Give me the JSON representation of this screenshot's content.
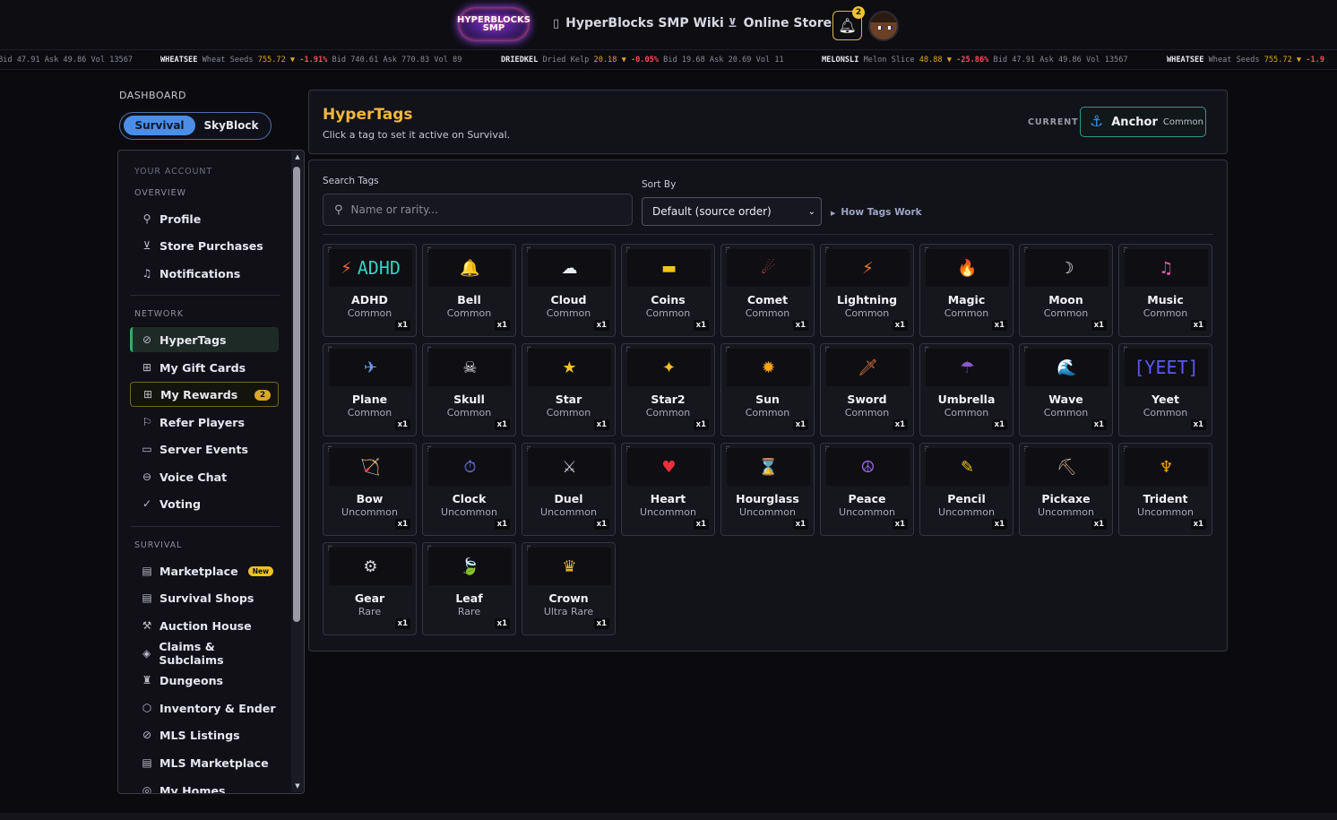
{
  "topnav": {
    "logo_line1": "HYPERBLOCKS",
    "logo_line2": "SMP",
    "wiki_label": "HyperBlocks SMP Wiki",
    "wiki_icon": "book-icon",
    "store_label": "Online Store",
    "store_icon": "cart-icon",
    "notification_count": "2"
  },
  "ticker": [
    {
      "sym": "",
      "name": "",
      "price": "",
      "chg": "",
      "rest": "Bid 47.91 Ask 49.86 Vol 13567"
    },
    {
      "sym": "WHEATSEE",
      "name": "Wheat Seeds",
      "price": "755.72 ▼",
      "chg": "-1.91%",
      "rest": "Bid 740.61 Ask 770.83 Vol 89"
    },
    {
      "sym": "DRIEDKEL",
      "name": "Dried Kelp",
      "price": "20.18 ▼",
      "chg": "-0.05%",
      "rest": "Bid 19.68 Ask 20.69 Vol 11"
    },
    {
      "sym": "MELONSLI",
      "name": "Melon Slice",
      "price": "48.88 ▼",
      "chg": "-25.86%",
      "rest": "Bid 47.91 Ask 49.86 Vol 13567"
    },
    {
      "sym": "WHEATSEE",
      "name": "Wheat Seeds",
      "price": "755.72 ▼",
      "chg": "-1.9",
      "rest": ""
    }
  ],
  "dashboard": {
    "label": "DASHBOARD",
    "mode_active": "Survival",
    "mode_other": "SkyBlock"
  },
  "sidebar": {
    "your_account": "YOUR ACCOUNT",
    "overview": "OVERVIEW",
    "network": "NETWORK",
    "survival": "SURVIVAL",
    "items": [
      {
        "label": "Profile",
        "icon": "user-icon"
      },
      {
        "label": "Store Purchases",
        "icon": "cart-icon"
      },
      {
        "label": "Notifications",
        "icon": "bell-icon"
      },
      {
        "label": "HyperTags",
        "icon": "tag-icon"
      },
      {
        "label": "My Gift Cards",
        "icon": "gift-icon"
      },
      {
        "label": "My Rewards",
        "icon": "gift-icon",
        "badge": "2"
      },
      {
        "label": "Refer Players",
        "icon": "flag-icon"
      },
      {
        "label": "Server Events",
        "icon": "calendar-icon"
      },
      {
        "label": "Voice Chat",
        "icon": "voice-icon"
      },
      {
        "label": "Voting",
        "icon": "check-circle-icon"
      },
      {
        "label": "Marketplace",
        "icon": "store-icon",
        "badge": "New"
      },
      {
        "label": "Survival Shops",
        "icon": "store-icon"
      },
      {
        "label": "Auction House",
        "icon": "gavel-icon"
      },
      {
        "label": "Claims & Subclaims",
        "icon": "layers-icon"
      },
      {
        "label": "Dungeons",
        "icon": "castle-icon"
      },
      {
        "label": "Inventory & Ender",
        "icon": "box-icon"
      },
      {
        "label": "MLS Listings",
        "icon": "tag-icon"
      },
      {
        "label": "MLS Marketplace",
        "icon": "store-icon"
      },
      {
        "label": "My Homes",
        "icon": "home-icon"
      }
    ]
  },
  "header": {
    "title": "HyperTags",
    "subtitle": "Click a tag to set it active on Survival.",
    "current_label": "CURRENT",
    "current_tag": "Anchor",
    "current_rarity": "Common"
  },
  "controls": {
    "search_label": "Search Tags",
    "search_placeholder": "Name or rarity...",
    "sort_label": "Sort By",
    "sort_value": "Default (source order)",
    "how_label": "How Tags Work"
  },
  "colors": {
    "accent_gold": "#f0b840",
    "active_green": "#3ca66a",
    "sort_blue": "#4a8ee8"
  },
  "tags": [
    {
      "name": "ADHD",
      "rarity": "Common",
      "qty": "x1",
      "icon": "⚡",
      "icon_text": "ADHD",
      "icon_color": "#f06a3a",
      "text_color": "#36d0c0"
    },
    {
      "name": "Bell",
      "rarity": "Common",
      "qty": "x1",
      "icon": "🔔",
      "icon_color": "#f5b830"
    },
    {
      "name": "Cloud",
      "rarity": "Common",
      "qty": "x1",
      "icon": "☁",
      "icon_color": "#e8ecf4"
    },
    {
      "name": "Coins",
      "rarity": "Common",
      "qty": "x1",
      "icon": "▬",
      "icon_color": "#f2c51e"
    },
    {
      "name": "Comet",
      "rarity": "Common",
      "qty": "x1",
      "icon": "☄",
      "icon_color": "#e85050"
    },
    {
      "name": "Lightning",
      "rarity": "Common",
      "qty": "x1",
      "icon": "⚡",
      "icon_color": "#f07a2a"
    },
    {
      "name": "Magic",
      "rarity": "Common",
      "qty": "x1",
      "icon": "🔥",
      "icon_color": "#f2652a"
    },
    {
      "name": "Moon",
      "rarity": "Common",
      "qty": "x1",
      "icon": "☽",
      "icon_color": "#f2f2f2"
    },
    {
      "name": "Music",
      "rarity": "Common",
      "qty": "x1",
      "icon": "♫",
      "icon_color": "#e85aa8"
    },
    {
      "name": "Plane",
      "rarity": "Common",
      "qty": "x1",
      "icon": "✈",
      "icon_color": "#6a9af0"
    },
    {
      "name": "Skull",
      "rarity": "Common",
      "qty": "x1",
      "icon": "☠",
      "icon_color": "#f0f0f0"
    },
    {
      "name": "Star",
      "rarity": "Common",
      "qty": "x1",
      "icon": "★",
      "icon_color": "#f5c21a"
    },
    {
      "name": "Star2",
      "rarity": "Common",
      "qty": "x1",
      "icon": "✦",
      "icon_color": "#f5c21a"
    },
    {
      "name": "Sun",
      "rarity": "Common",
      "qty": "x1",
      "icon": "✹",
      "icon_color": "#f5a51a"
    },
    {
      "name": "Sword",
      "rarity": "Common",
      "qty": "x1",
      "icon": "🗡",
      "icon_color": "#e07a3a"
    },
    {
      "name": "Umbrella",
      "rarity": "Common",
      "qty": "x1",
      "icon": "☂",
      "icon_color": "#8a5ac8"
    },
    {
      "name": "Wave",
      "rarity": "Common",
      "qty": "x1",
      "icon": "🌊",
      "icon_color": "#3a8ae8"
    },
    {
      "name": "Yeet",
      "rarity": "Common",
      "qty": "x1",
      "icon": "",
      "icon_text": "[YEET]",
      "text_color": "#5a5af0"
    },
    {
      "name": "Bow",
      "rarity": "Uncommon",
      "qty": "x1",
      "icon": "🏹",
      "icon_color": "#e06a3a"
    },
    {
      "name": "Clock",
      "rarity": "Uncommon",
      "qty": "x1",
      "icon": "⏱",
      "icon_color": "#6a7af0"
    },
    {
      "name": "Duel",
      "rarity": "Uncommon",
      "qty": "x1",
      "icon": "⚔",
      "icon_color": "#c8c8d8"
    },
    {
      "name": "Heart",
      "rarity": "Uncommon",
      "qty": "x1",
      "icon": "♥",
      "icon_color": "#e8303a"
    },
    {
      "name": "Hourglass",
      "rarity": "Uncommon",
      "qty": "x1",
      "icon": "⌛",
      "icon_color": "#e8e8e8"
    },
    {
      "name": "Peace",
      "rarity": "Uncommon",
      "qty": "x1",
      "icon": "☮",
      "icon_color": "#9a6ae8"
    },
    {
      "name": "Pencil",
      "rarity": "Uncommon",
      "qty": "x1",
      "icon": "✎",
      "icon_color": "#f2c21a"
    },
    {
      "name": "Pickaxe",
      "rarity": "Uncommon",
      "qty": "x1",
      "icon": "⛏",
      "icon_color": "#c8a890"
    },
    {
      "name": "Trident",
      "rarity": "Uncommon",
      "qty": "x1",
      "icon": "♆",
      "icon_color": "#f0a51a"
    },
    {
      "name": "Gear",
      "rarity": "Rare",
      "qty": "x1",
      "icon": "⚙",
      "icon_color": "#d8d8e0"
    },
    {
      "name": "Leaf",
      "rarity": "Rare",
      "qty": "x1",
      "icon": "🍃",
      "icon_color": "#3ab85a"
    },
    {
      "name": "Crown",
      "rarity": "Ultra Rare",
      "qty": "x1",
      "icon": "♛",
      "icon_color": "#f5b820"
    }
  ]
}
